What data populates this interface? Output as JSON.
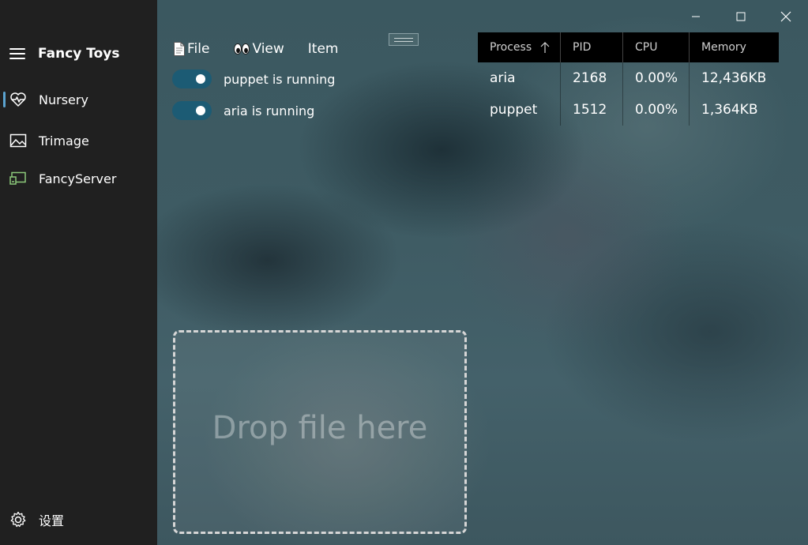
{
  "app": {
    "title": "Fancy Toys"
  },
  "sidebar": {
    "items": [
      {
        "label": "Nursery",
        "icon": "heart-pulse-icon",
        "selected": true
      },
      {
        "label": "Trimage",
        "icon": "image-icon",
        "selected": false
      },
      {
        "label": "FancyServer",
        "icon": "server-icon",
        "selected": false
      }
    ],
    "settings_label": "设置"
  },
  "menu": {
    "file_label": "File",
    "view_label": "View",
    "item_label": "Item"
  },
  "toggles": [
    {
      "label": "puppet is running",
      "on": true
    },
    {
      "label": "aria is running",
      "on": true
    }
  ],
  "process_table": {
    "columns": [
      "Process",
      "PID",
      "CPU",
      "Memory"
    ],
    "sort_column": "Process",
    "sort_direction": "ascending",
    "rows": [
      {
        "process": "aria",
        "pid": "2168",
        "cpu": "0.00%",
        "memory": "12,436KB"
      },
      {
        "process": "puppet",
        "pid": "1512",
        "cpu": "0.00%",
        "memory": "1,364KB"
      }
    ]
  },
  "dropzone": {
    "label": "Drop file here"
  },
  "colors": {
    "sidebar_bg": "#202020",
    "accent": "#5ba3d0",
    "toggle_on": "#1c5b74",
    "table_header_bg": "#000000"
  }
}
